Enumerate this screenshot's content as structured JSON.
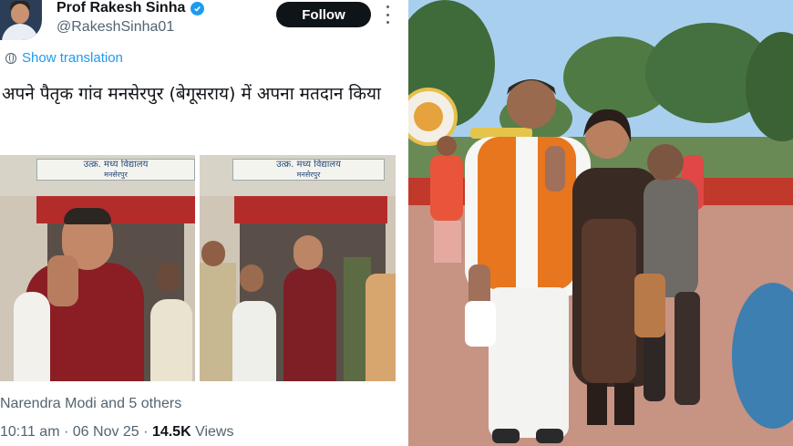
{
  "tweet": {
    "display_name": "Prof Rakesh Sinha",
    "handle": "@RakeshSinha01",
    "follow_label": "Follow",
    "translate_label": "Show translation",
    "text": "अपने पैतृक गांव मनसेरपुर (बेगूसराय) में अपना मतदान किया",
    "photo_sign_line1": "उत्क्र. मध्य विद्यालय",
    "photo_sign_line2": "मनसेरपुर",
    "engagement": "Narendra Modi and 5 others",
    "time": "10:11 am",
    "separator1": "·",
    "date": "06 Nov 25",
    "separator2": "·",
    "views_count": "14.5K",
    "views_label": "Views"
  },
  "colors": {
    "accent": "#1d9bf0",
    "text": "#0f1419",
    "muted": "#536471",
    "follow_bg": "#0f1419"
  },
  "icons": [
    "verified-badge-icon",
    "more-options-icon",
    "globe-translate-icon"
  ]
}
